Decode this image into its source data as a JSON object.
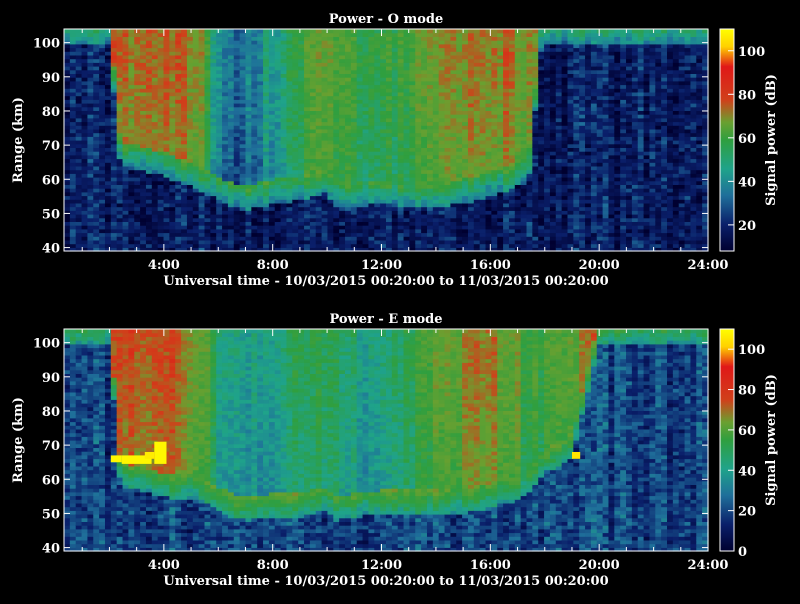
{
  "colors": {
    "background": "#000000",
    "axis": "#ffffff",
    "colormap": [
      "#000030",
      "#0a1f6a",
      "#1f6f9a",
      "#1fa38a",
      "#2f9f3f",
      "#6aa030",
      "#d0401a",
      "#e01818",
      "#ffd000",
      "#ffff00"
    ]
  },
  "chart_data": [
    {
      "type": "heatmap",
      "title": "Power - O mode",
      "xlabel": "Universal time - 10/03/2015 00:20:00 to 11/03/2015 00:20:00",
      "ylabel": "Range (km)",
      "colorbar_label": "Signal power (dB)",
      "x_ticks": [
        "4:00",
        "8:00",
        "12:00",
        "16:00",
        "20:00",
        "24:00"
      ],
      "x_tick_hours": [
        4,
        8,
        12,
        16,
        20,
        24
      ],
      "y_ticks": [
        "40",
        "50",
        "60",
        "70",
        "80",
        "90",
        "100"
      ],
      "colorbar_ticks": [
        "20",
        "40",
        "60",
        "80",
        "100"
      ],
      "xlim": [
        0.33,
        24.0
      ],
      "ylim": [
        39,
        104
      ],
      "clim": [
        8,
        110
      ],
      "profile": {
        "hours": [
          0.33,
          1.5,
          2.0,
          2.4,
          3.0,
          3.5,
          4.0,
          5.0,
          5.5,
          6.0,
          6.5,
          7.0,
          8.0,
          9.0,
          10.0,
          10.3,
          11.0,
          12.0,
          13.0,
          14.0,
          15.0,
          16.0,
          17.0,
          17.4,
          17.9,
          18.5,
          19.0,
          20.0,
          21.0,
          22.0,
          23.0,
          24.0
        ],
        "boundary_km": [
          104,
          104,
          104,
          68,
          67,
          66,
          65,
          62,
          60,
          58,
          56,
          55,
          57,
          58,
          60,
          56,
          56,
          57,
          56,
          56,
          57,
          59,
          62,
          63,
          104,
          104,
          104,
          104,
          104,
          104,
          104,
          104
        ],
        "top_power_db": [
          68,
          70,
          72,
          70,
          72,
          74,
          74,
          70,
          60,
          38,
          32,
          34,
          42,
          55,
          62,
          62,
          56,
          52,
          58,
          64,
          70,
          72,
          68,
          66,
          64,
          65,
          66,
          74,
          72,
          56,
          50,
          50
        ]
      }
    },
    {
      "type": "heatmap",
      "title": "Power - E mode",
      "xlabel": "Universal time - 10/03/2015 00:20:00 to 11/03/2015 00:20:00",
      "ylabel": "Range (km)",
      "colorbar_label": "Signal power (dB)",
      "x_ticks": [
        "4:00",
        "8:00",
        "12:00",
        "16:00",
        "20:00",
        "24:00"
      ],
      "x_tick_hours": [
        4,
        8,
        12,
        16,
        20,
        24
      ],
      "y_ticks": [
        "40",
        "50",
        "60",
        "70",
        "80",
        "90",
        "100"
      ],
      "colorbar_ticks": [
        "0",
        "20",
        "40",
        "60",
        "80",
        "100"
      ],
      "xlim": [
        0.33,
        24.0
      ],
      "ylim": [
        39,
        104
      ],
      "clim": [
        0,
        110
      ],
      "profile": {
        "hours": [
          0.33,
          1.5,
          2.0,
          2.4,
          3.0,
          3.5,
          4.0,
          5.0,
          5.5,
          6.0,
          6.5,
          7.0,
          8.0,
          9.0,
          10.0,
          10.3,
          11.0,
          12.0,
          13.0,
          14.0,
          15.0,
          16.0,
          17.0,
          17.4,
          18.0,
          18.5,
          19.0,
          20.0,
          21.0,
          22.0,
          23.0,
          24.0
        ],
        "boundary_km": [
          104,
          104,
          104,
          62,
          61,
          60,
          59,
          58,
          57,
          55,
          53,
          52,
          53,
          53,
          55,
          52,
          53,
          54,
          54,
          54,
          54,
          56,
          58,
          60,
          66,
          68,
          70,
          104,
          104,
          104,
          104,
          104
        ],
        "top_power_db": [
          68,
          70,
          72,
          72,
          72,
          74,
          72,
          66,
          58,
          40,
          34,
          34,
          36,
          44,
          50,
          46,
          40,
          38,
          44,
          56,
          64,
          66,
          58,
          52,
          50,
          54,
          58,
          70,
          72,
          70,
          64,
          60
        ]
      },
      "highlights": [
        {
          "h0": 2.05,
          "h1": 2.45,
          "r0": 65,
          "r1": 67,
          "db": 108
        },
        {
          "h0": 2.45,
          "h1": 3.55,
          "r0": 64.5,
          "r1": 67,
          "db": 108
        },
        {
          "h0": 3.3,
          "h1": 3.65,
          "r0": 66,
          "r1": 68,
          "db": 105
        },
        {
          "h0": 3.65,
          "h1": 4.1,
          "r0": 64.5,
          "r1": 71,
          "db": 108
        },
        {
          "h0": 19.0,
          "h1": 19.3,
          "r0": 66,
          "r1": 68,
          "db": 104
        }
      ]
    }
  ]
}
